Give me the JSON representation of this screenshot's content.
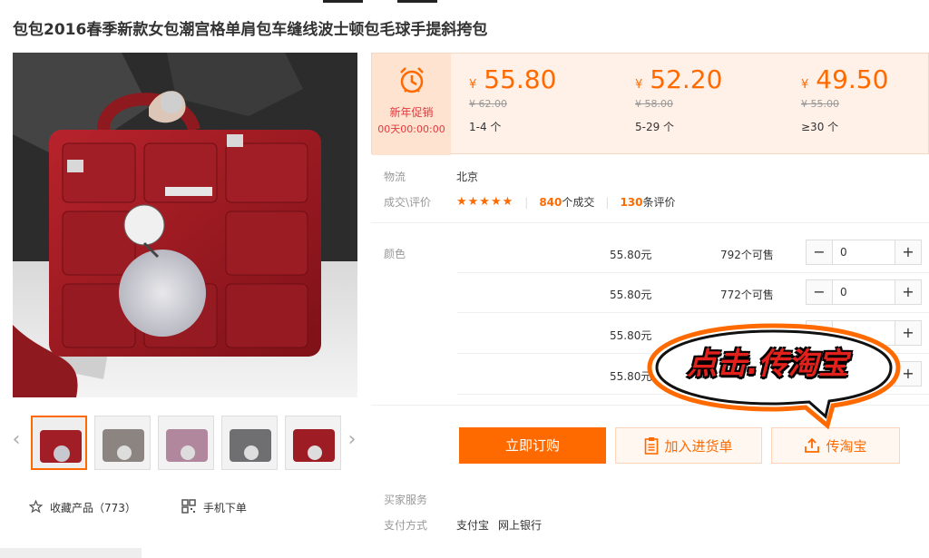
{
  "product": {
    "title": "包包2016春季新款女包潮宫格单肩包车缝线波士顿包毛球手提斜挎包",
    "thumbnails": [
      "thumb-1",
      "thumb-2",
      "thumb-3",
      "thumb-4",
      "thumb-5"
    ]
  },
  "promo": {
    "label": "新年促销",
    "countdown": "00天00:00:00"
  },
  "price_tiers": [
    {
      "currency": "¥",
      "price": "55.80",
      "original": "¥ 62.00",
      "range": "1-4 个"
    },
    {
      "currency": "¥",
      "price": "52.20",
      "original": "¥ 58.00",
      "range": "5-29 个"
    },
    {
      "currency": "¥",
      "price": "49.50",
      "original": "¥ 55.00",
      "range": "≥30 个"
    }
  ],
  "logistics": {
    "label": "物流",
    "value": "北京"
  },
  "reviews": {
    "label": "成交\\评价",
    "stars": "★★★★★",
    "deals_count": "840",
    "deals_text": "个成交",
    "review_count": "130",
    "review_text": "条评价"
  },
  "sku": {
    "color_label": "颜色",
    "rows": [
      {
        "price": "55.80元",
        "stock": "792个可售",
        "qty": "0"
      },
      {
        "price": "55.80元",
        "stock": "772个可售",
        "qty": "0"
      },
      {
        "price": "55.80元",
        "stock": "",
        "qty": ""
      },
      {
        "price": "55.80元",
        "stock": "",
        "qty": ""
      }
    ],
    "minus": "−",
    "plus": "+"
  },
  "actions": {
    "order": "立即订购",
    "cart": "加入进货单",
    "taobao": "传淘宝"
  },
  "callout": {
    "text": "点击.传淘宝"
  },
  "favorites": {
    "fav_label": "收藏产品（773）",
    "mobile_label": "手机下单"
  },
  "services": {
    "buyer_label": "买家服务",
    "payment_label": "支付方式",
    "payment_1": "支付宝",
    "payment_2": "网上银行"
  },
  "colors": {
    "accent": "#ff6a00",
    "promo_red": "#e4393c",
    "callout_red": "#e2211c"
  }
}
